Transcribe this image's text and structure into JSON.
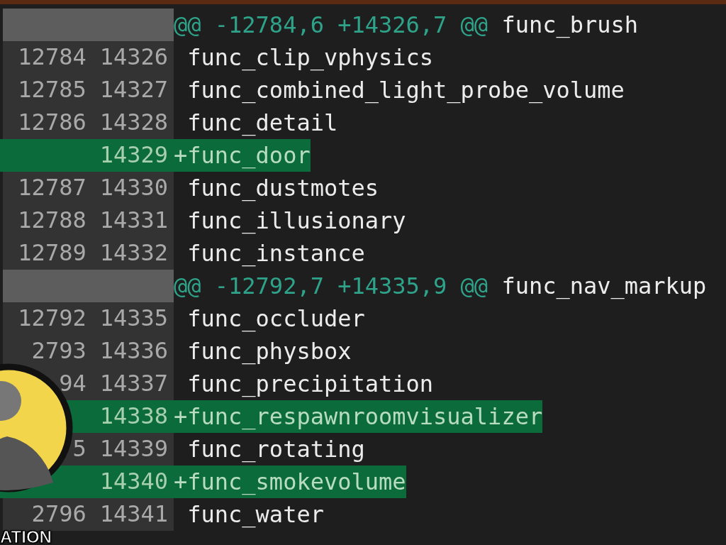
{
  "hunks": [
    {
      "header": {
        "range": "@@ -12784,6 +14326,7 @@",
        "context": "func_brush"
      },
      "lines": [
        {
          "kind": "context",
          "old": "12784",
          "new": "14326",
          "text": "func_clip_vphysics"
        },
        {
          "kind": "context",
          "old": "12785",
          "new": "14327",
          "text": "func_combined_light_probe_volume"
        },
        {
          "kind": "context",
          "old": "12786",
          "new": "14328",
          "text": "func_detail"
        },
        {
          "kind": "added",
          "new": "14329",
          "text": "+func_door"
        },
        {
          "kind": "context",
          "old": "12787",
          "new": "14330",
          "text": "func_dustmotes"
        },
        {
          "kind": "context",
          "old": "12788",
          "new": "14331",
          "text": "func_illusionary"
        },
        {
          "kind": "context",
          "old": "12789",
          "new": "14332",
          "text": "func_instance"
        }
      ]
    },
    {
      "header": {
        "range": "@@ -12792,7 +14335,9 @@",
        "context": "func_nav_markup"
      },
      "lines": [
        {
          "kind": "context",
          "old": "12792",
          "new": "14335",
          "text": "func_occluder"
        },
        {
          "kind": "context",
          "old": "2793",
          "new": "14336",
          "text": "func_physbox"
        },
        {
          "kind": "context",
          "old": "94",
          "new": "14337",
          "text": "func_precipitation"
        },
        {
          "kind": "added",
          "new": "14338",
          "text": "+func_respawnroomvisualizer"
        },
        {
          "kind": "context",
          "old": "5",
          "new": "14339",
          "text": "func_rotating"
        },
        {
          "kind": "added",
          "new": "14340",
          "text": "+func_smokevolume"
        },
        {
          "kind": "context",
          "old": "2796",
          "new": "14341",
          "text": "func_water"
        }
      ]
    }
  ],
  "overlay": {
    "caption": "ATION"
  }
}
